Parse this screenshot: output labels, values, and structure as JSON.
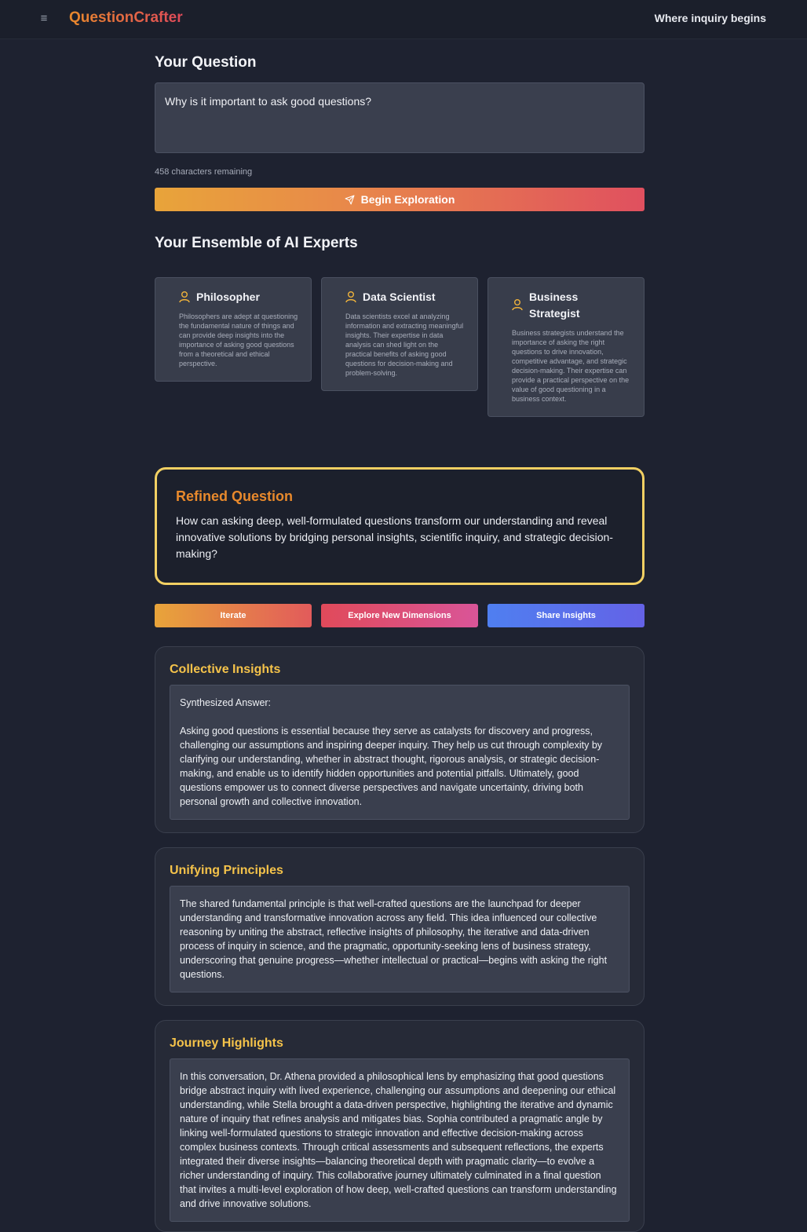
{
  "header": {
    "brand": "QuestionCrafter",
    "tagline": "Where inquiry begins"
  },
  "question": {
    "heading": "Your Question",
    "value": "Why is it important to ask good questions?",
    "chars_remaining": "458 characters remaining",
    "submit_label": "Begin Exploration"
  },
  "experts": {
    "heading": "Your Ensemble of AI Experts",
    "items": [
      {
        "name": "Philosopher",
        "description": "Philosophers are adept at questioning the fundamental nature of things and can provide deep insights into the importance of asking good questions from a theoretical and ethical perspective."
      },
      {
        "name": "Data Scientist",
        "description": "Data scientists excel at analyzing information and extracting meaningful insights. Their expertise in data analysis can shed light on the practical benefits of asking good questions for decision-making and problem-solving."
      },
      {
        "name": "Business Strategist",
        "description": "Business strategists understand the importance of asking the right questions to drive innovation, competitive advantage, and strategic decision-making. Their expertise can provide a practical perspective on the value of good questioning in a business context."
      }
    ]
  },
  "refined": {
    "title": "Refined Question",
    "text": "How can asking deep, well-formulated questions transform our understanding and reveal innovative solutions by bridging personal insights, scientific inquiry, and strategic decision-making?"
  },
  "actions": {
    "iterate": "Iterate",
    "explore": "Explore New Dimensions",
    "share": "Share Insights"
  },
  "insights": {
    "title": "Collective Insights",
    "label": "Synthesized Answer:",
    "text": "Asking good questions is essential because they serve as catalysts for discovery and progress, challenging our assumptions and inspiring deeper inquiry. They help us cut through complexity by clarifying our understanding, whether in abstract thought, rigorous analysis, or strategic decision-making, and enable us to identify hidden opportunities and potential pitfalls. Ultimately, good questions empower us to connect diverse perspectives and navigate uncertainty, driving both personal growth and collective innovation."
  },
  "principles": {
    "title": "Unifying Principles",
    "text": "The shared fundamental principle is that well-crafted questions are the launchpad for deeper understanding and transformative innovation across any field. This idea influenced our collective reasoning by uniting the abstract, reflective insights of philosophy, the iterative and data-driven process of inquiry in science, and the pragmatic, opportunity-seeking lens of business strategy, underscoring that genuine progress—whether intellectual or practical—begins with asking the right questions."
  },
  "journey": {
    "title": "Journey Highlights",
    "text": "In this conversation, Dr. Athena provided a philosophical lens by emphasizing that good questions bridge abstract inquiry with lived experience, challenging our assumptions and deepening our ethical understanding, while Stella brought a data-driven perspective, highlighting the iterative and dynamic nature of inquiry that refines analysis and mitigates bias. Sophia contributed a pragmatic angle by linking well-formulated questions to strategic innovation and effective decision-making across complex business contexts. Through critical assessments and subsequent reflections, the experts integrated their diverse insights—balancing theoretical depth with pragmatic clarity—to evolve a richer understanding of inquiry. This collaborative journey ultimately culminated in a final question that invites a multi-level exploration of how deep, well-crafted questions can transform understanding and drive innovative solutions."
  },
  "colors": {
    "accent_orange": "#e8892c",
    "accent_yellow": "#f5c34a",
    "accent_red": "#e04a5a",
    "share_blue": "#4f7ff0",
    "background": "#1e2230"
  }
}
